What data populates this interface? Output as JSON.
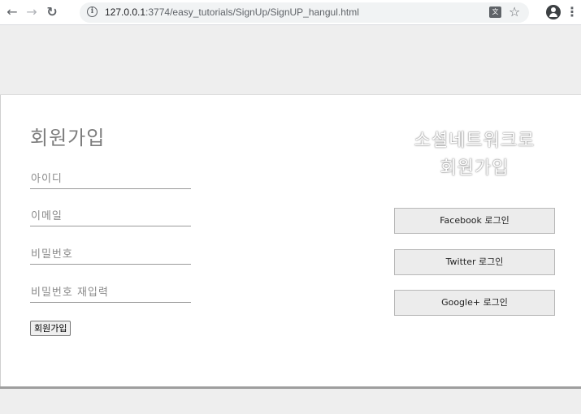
{
  "browser": {
    "url_host": "127.0.0.1",
    "url_path": ":3774/easy_tutorials/SignUp/SignUP_hangul.html",
    "back_icon": "back-arrow",
    "forward_icon": "forward-arrow",
    "reload_icon": "reload",
    "info_icon": "info",
    "translate_icon": "translate",
    "bookmark_icon": "star",
    "profile_icon": "account-circle",
    "menu_icon": "vertical-dots"
  },
  "signup": {
    "title": "회원가입",
    "id_placeholder": "아이디",
    "email_placeholder": "이메일",
    "password_placeholder": "비밀번호",
    "password_confirm_placeholder": "비밀번호 재입력",
    "submit_label": "회원가입"
  },
  "social": {
    "title_line1": "소셜네트워크로",
    "title_line2": "회원가입",
    "facebook_label": "Facebook 로그인",
    "twitter_label": "Twitter 로그인",
    "google_label": "Google+ 로그인"
  },
  "colors": {
    "page_bg": "#eeeeee",
    "panel_bg": "#ffffff",
    "button_bg": "#ececec"
  }
}
